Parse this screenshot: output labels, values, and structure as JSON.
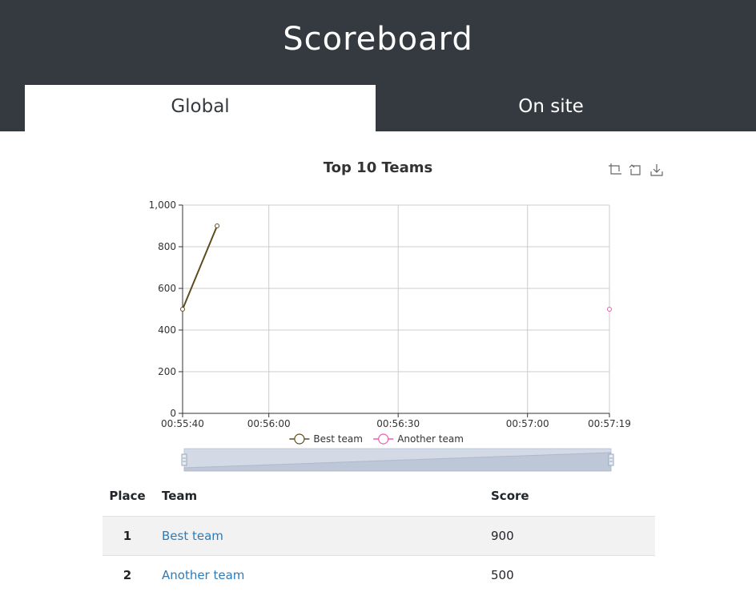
{
  "page": {
    "title": "Scoreboard"
  },
  "tabs": [
    {
      "label": "Global",
      "active": true
    },
    {
      "label": "On site",
      "active": false
    }
  ],
  "toolbox": {
    "icons": [
      "zoom-icon",
      "zoom-reset-icon",
      "download-icon"
    ]
  },
  "chart_data": {
    "type": "line",
    "title": "Top 10 Teams",
    "xlabel": "",
    "ylabel": "",
    "x_axis": {
      "type": "time",
      "range": [
        "00:55:40",
        "00:57:19"
      ],
      "ticks": [
        "00:55:40",
        "00:56:00",
        "00:56:30",
        "00:57:00",
        "00:57:19"
      ]
    },
    "y_axis": {
      "range": [
        0,
        1000
      ],
      "ticks": [
        "0",
        "200",
        "400",
        "600",
        "800",
        "1,000"
      ]
    },
    "grid": true,
    "legend_position": "bottom",
    "series": [
      {
        "name": "Best team",
        "color": "#5e4b1f",
        "points": [
          {
            "x": "00:55:40",
            "y": 500
          },
          {
            "x": "00:55:48",
            "y": 900
          }
        ]
      },
      {
        "name": "Another team",
        "color": "#e85fb0",
        "points": [
          {
            "x": "00:57:19",
            "y": 500
          }
        ]
      }
    ],
    "data_zoom": {
      "start": 0,
      "end": 100
    }
  },
  "table": {
    "headers": {
      "place": "Place",
      "team": "Team",
      "score": "Score"
    },
    "rows": [
      {
        "place": "1",
        "team": "Best team",
        "score": "900"
      },
      {
        "place": "2",
        "team": "Another team",
        "score": "500"
      }
    ]
  }
}
